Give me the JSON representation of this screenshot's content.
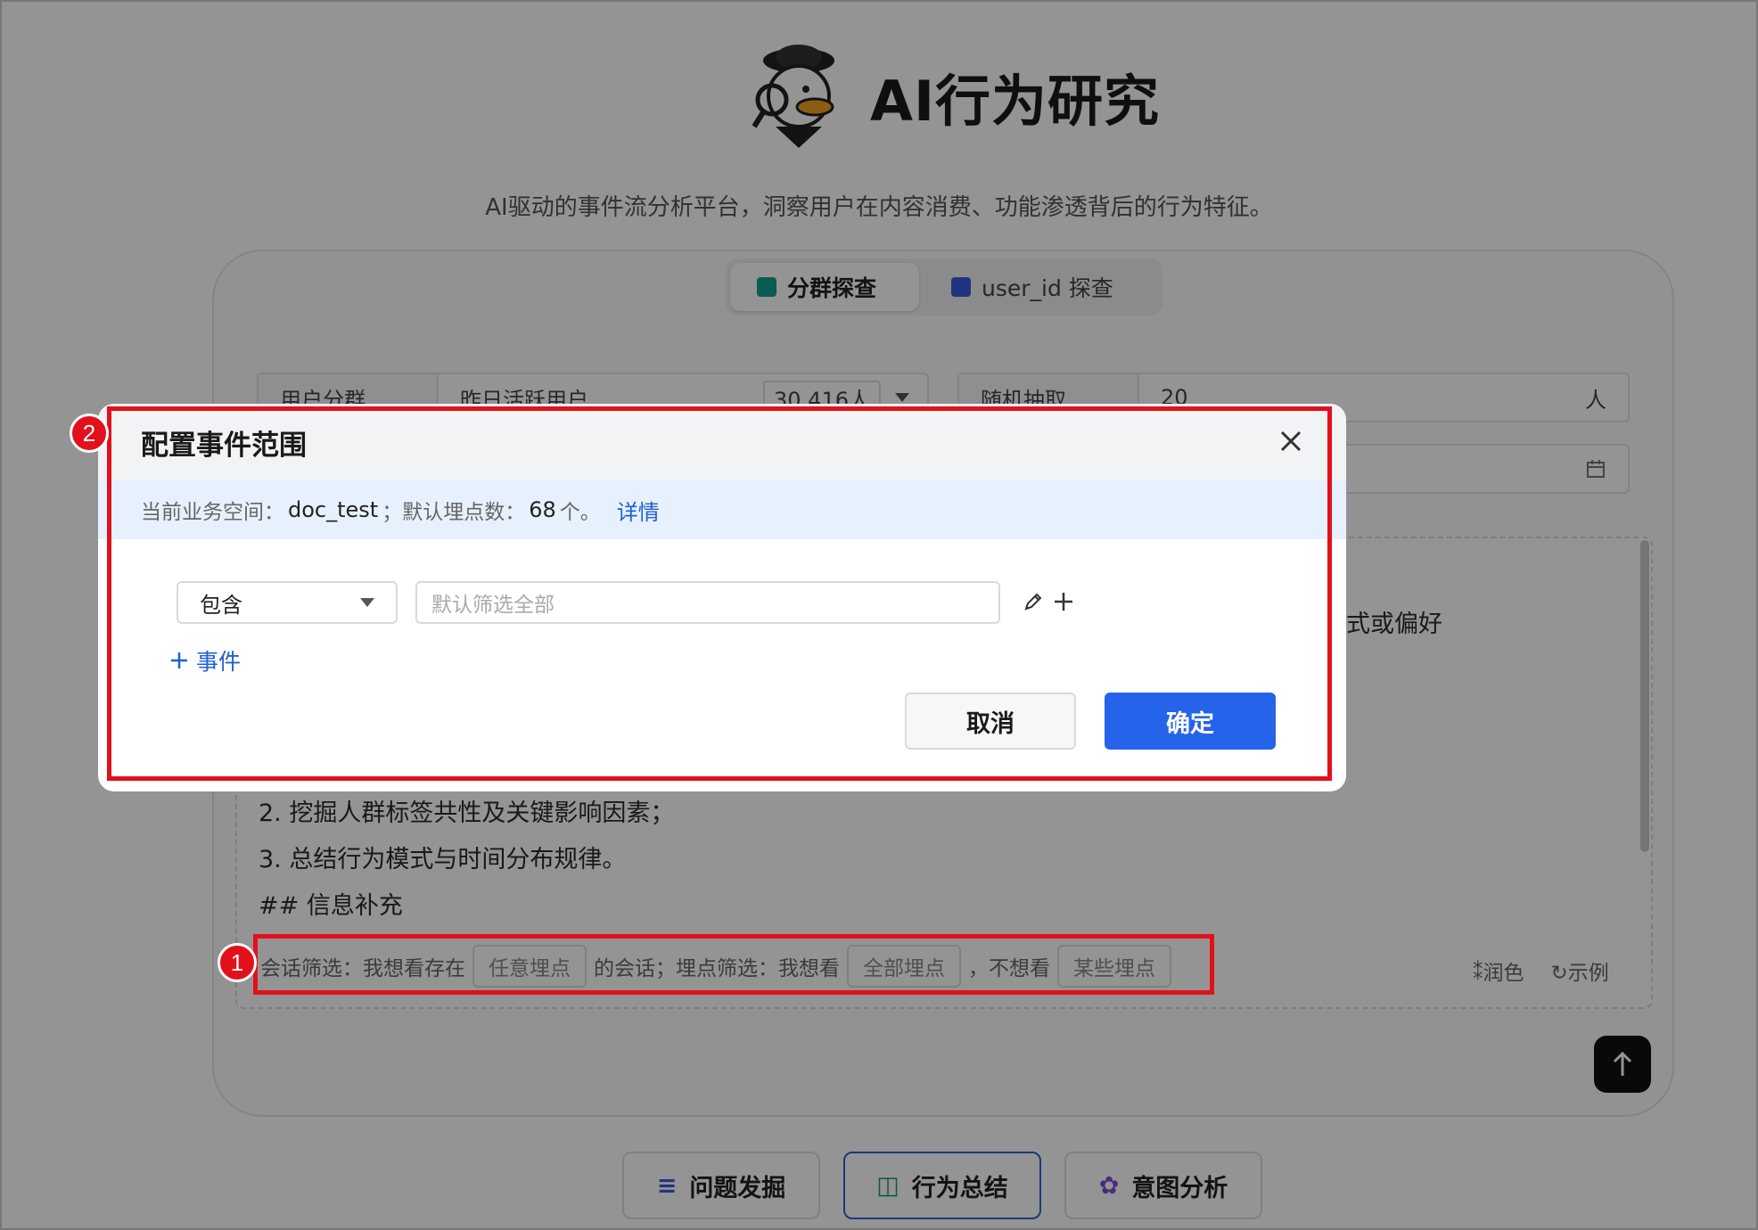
{
  "brand": {
    "title": "AI行为研究",
    "subtitle": "AI驱动的事件流分析平台，洞察用户在内容消费、功能渗透背后的行为特征。"
  },
  "tabs": [
    {
      "label": "分群探查",
      "active": true
    },
    {
      "label": "user_id 探查",
      "active": false
    }
  ],
  "form": {
    "segment_label": "用户分群",
    "segment_value": "昨日活跃用户",
    "segment_count": "30,416人",
    "sample_label": "随机抽取",
    "sample_value": "20",
    "sample_unit": "人"
  },
  "editor": {
    "partial_text": "式或偏好",
    "lines": [
      "2. 挖掘人群标签共性及关键影响因素；",
      "3. 总结行为模式与时间分布规律。",
      "## 信息补充"
    ]
  },
  "filter": {
    "prefix": "会话筛选：我想看存在",
    "chip1": "任意埋点",
    "mid": "的会话；埋点筛选：我想看",
    "chip2": "全部埋点",
    "mid2": "，不想看",
    "chip3": "某些埋点",
    "polish": "润色",
    "example": "示例"
  },
  "bottom_buttons": [
    {
      "label": "问题发掘",
      "selected": false
    },
    {
      "label": "行为总结",
      "selected": true
    },
    {
      "label": "意图分析",
      "selected": false
    }
  ],
  "modal": {
    "title": "配置事件范围",
    "info_prefix": "当前业务空间：",
    "workspace": "doc_test",
    "info_mid": "；默认埋点数：",
    "count": "68",
    "info_suffix": "个。",
    "details": "详情",
    "condition": "包含",
    "placeholder": "默认筛选全部",
    "add_event": "事件",
    "cancel": "取消",
    "ok": "确定"
  },
  "annotations": {
    "badge1": "1",
    "badge2": "2"
  },
  "colors": {
    "primary": "#2563eb",
    "annotation": "#e3101c",
    "link": "#1f5fd6"
  }
}
